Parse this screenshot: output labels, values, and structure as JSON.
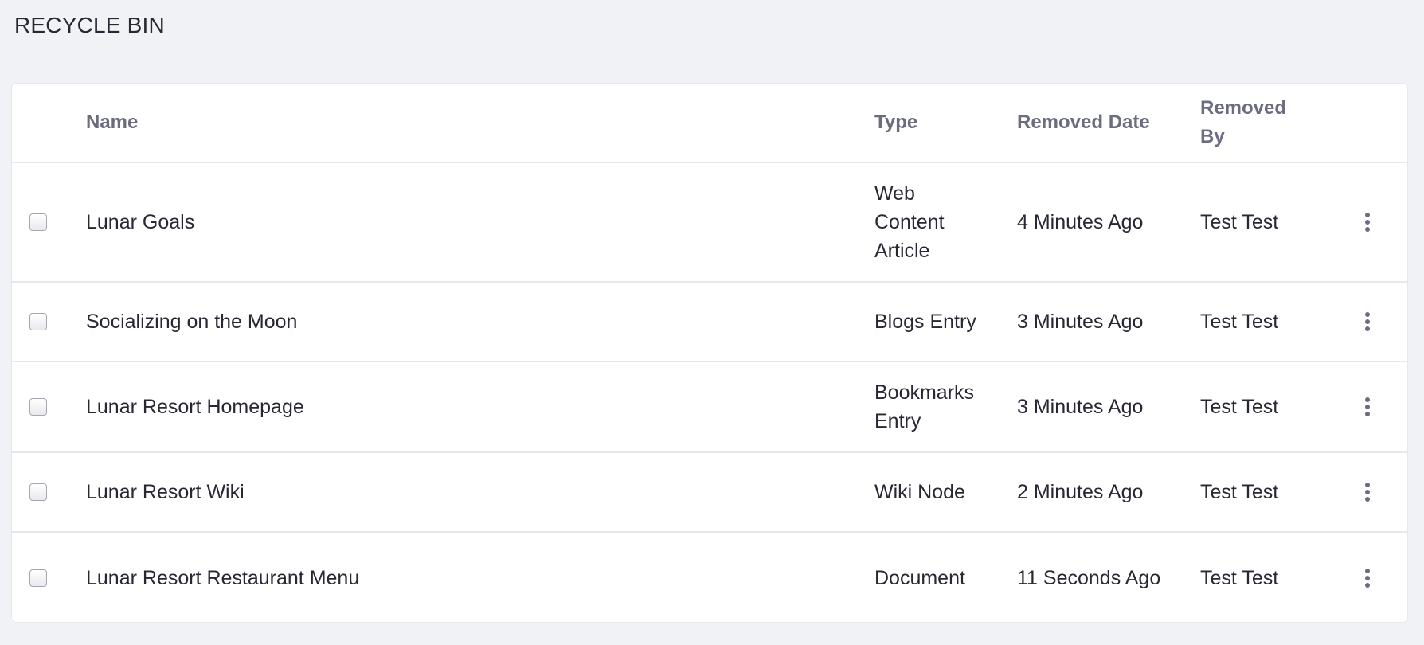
{
  "page": {
    "title": "RECYCLE BIN"
  },
  "table": {
    "columns": {
      "name": "Name",
      "type": "Type",
      "removed_date": "Removed Date",
      "removed_by": "Removed By"
    },
    "rows": [
      {
        "name": "Lunar Goals",
        "type": "Web Content Article",
        "removed_date": "4 Minutes Ago",
        "removed_by": "Test Test"
      },
      {
        "name": "Socializing on the Moon",
        "type": "Blogs Entry",
        "removed_date": "3 Minutes Ago",
        "removed_by": "Test Test"
      },
      {
        "name": "Lunar Resort Homepage",
        "type": "Bookmarks Entry",
        "removed_date": "3 Minutes Ago",
        "removed_by": "Test Test"
      },
      {
        "name": "Lunar Resort Wiki",
        "type": "Wiki Node",
        "removed_date": "2 Minutes Ago",
        "removed_by": "Test Test"
      },
      {
        "name": "Lunar Resort Restaurant Menu",
        "type": "Document",
        "removed_date": "11 Seconds Ago",
        "removed_by": "Test Test"
      }
    ]
  },
  "icons": {
    "row_actions": "ellipsis-vertical-icon",
    "row_select": "checkbox-icon"
  },
  "colors": {
    "background": "#f1f2f5",
    "header_text": "#6b6c7e",
    "text": "#272833",
    "border": "#e7e7ed"
  }
}
